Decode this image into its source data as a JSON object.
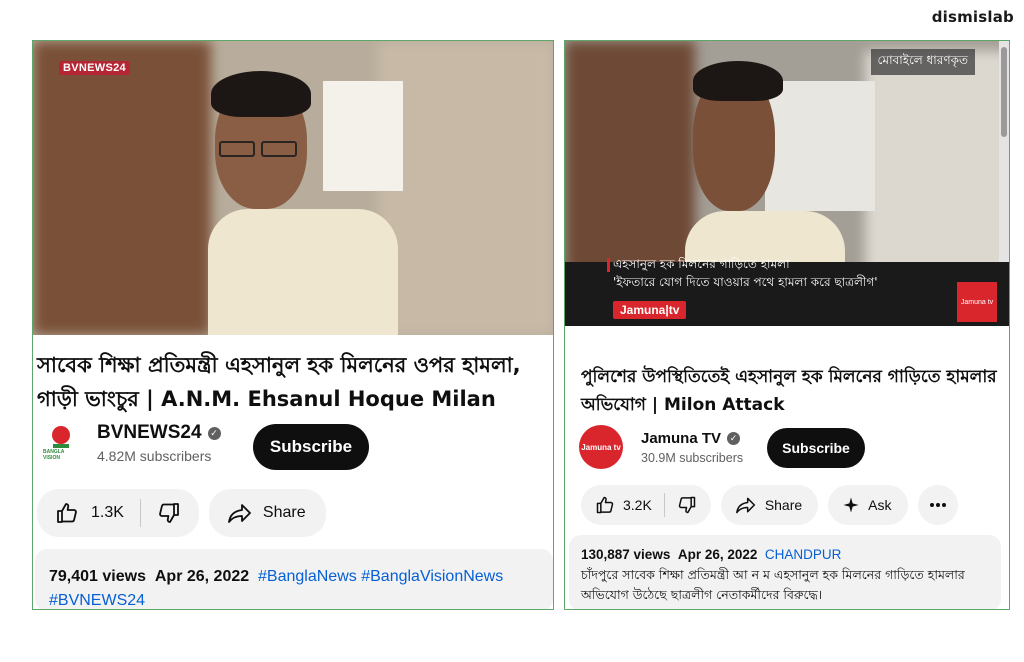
{
  "brand": "dismislab",
  "left": {
    "video": {
      "logo_overlay": "BVNEWS24"
    },
    "title": "সাবেক শিক্ষা প্রতিমন্ত্রী এহসানুল হক মিলনের ওপর হামলা, গাড়ী ভাংচুর | A.N.M. Ehsanul Hoque Milan",
    "channel": {
      "name": "BVNEWS24",
      "subscribers": "4.82M subscribers",
      "avatar_text": "BANGLA VISION"
    },
    "subscribe_label": "Subscribe",
    "actions": {
      "likes": "1.3K",
      "share_label": "Share"
    },
    "description": {
      "views": "79,401 views",
      "date": "Apr 26, 2022",
      "hashtags": [
        "#BanglaNews",
        "#BanglaVisionNews",
        "#BVNEWS24"
      ]
    }
  },
  "right": {
    "video": {
      "tag_overlay": "মোবাইলে ধারণকৃত",
      "headline_1": "এহসানুল হক মিলনের গাড়িতে হামলা",
      "headline_2": "'ইফতারে যোগ দিতে যাওয়ার পথে হামলা করে ছাত্রলীগ'",
      "channel_bug": "Jamuna|tv",
      "corner_bug": "Jamuna tv"
    },
    "title": "পুলিশের উপস্থিতিতেই এহসানুল হক মিলনের গাড়িতে হামলার অভিযোগ | Milon Attack",
    "channel": {
      "name": "Jamuna TV",
      "subscribers": "30.9M subscribers",
      "avatar_text": "Jamuna tv"
    },
    "subscribe_label": "Subscribe",
    "actions": {
      "likes": "3.2K",
      "share_label": "Share",
      "ask_label": "Ask"
    },
    "description": {
      "views": "130,887 views",
      "date": "Apr 26, 2022",
      "location": "CHANDPUR",
      "text": "চাঁদপুরে সাবেক শিক্ষা প্রতিমন্ত্রী আ ন ম এহসানুল হক মিলনের গাড়িতে হামলার অভিযোগ উঠেছে ছাত্রলীগ নেতাকর্মীদের বিরুদ্ধে।"
    }
  }
}
